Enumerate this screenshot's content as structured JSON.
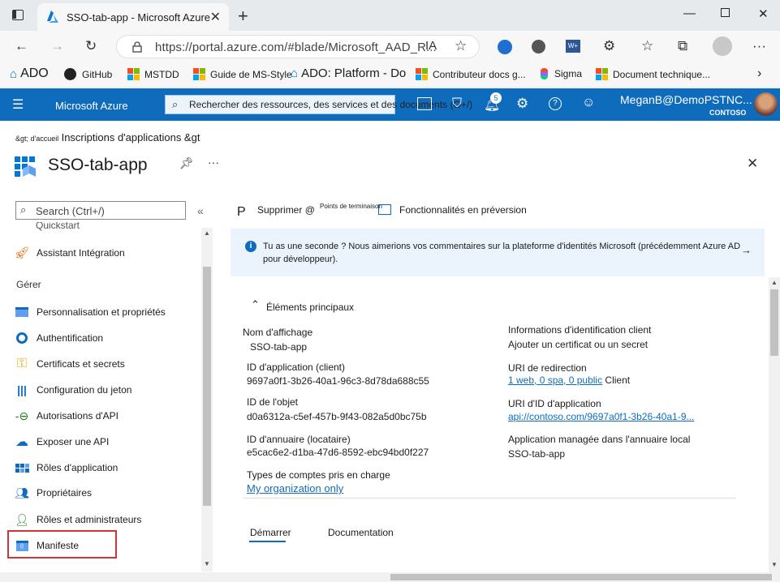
{
  "browser": {
    "tab_title": "SSO-tab-app - Microsoft Azure",
    "url": "https://portal.azure.com/#blade/Microsoft_AAD_R...",
    "address_suffix": "IA",
    "extension_badge": "W+",
    "bookmarks": [
      {
        "label": "ADO",
        "icon": "ado-icon"
      },
      {
        "label": "GitHub",
        "icon": "github-icon"
      },
      {
        "label": "MSTDD",
        "icon": "microsoft-icon"
      },
      {
        "label": "Guide de MS-Style",
        "icon": "microsoft-icon"
      },
      {
        "label": "ADO: Platform - Do",
        "icon": "ado-icon"
      },
      {
        "label": "Contributeur docs g...",
        "icon": "microsoft-icon"
      },
      {
        "label": "Sigma",
        "icon": "figma-icon"
      },
      {
        "label": "Document technique...",
        "icon": "microsoft-icon"
      }
    ]
  },
  "azure": {
    "brand": "Microsoft Azure",
    "search_placeholder": "Rechercher des ressources, des services et des documents (G+/)",
    "notification_count": "5",
    "user_name": "MeganB@DemoPSTNC...",
    "tenant": "CONTOSO"
  },
  "breadcrumb": {
    "part1": "&gt; d'accueil",
    "part2": "Inscriptions d'applications &gt"
  },
  "blade": {
    "title": "SSO-tab-app",
    "search_placeholder": "Search (Ctrl+/)",
    "collapse": "«",
    "cutoff_item": "Quickstart",
    "integration_item": "Assistant Intégration",
    "manage_header": "Gérer",
    "manage_items": [
      {
        "label": "Personnalisation et propriétés",
        "icon": "branding-icon"
      },
      {
        "label": "Authentification",
        "icon": "authentication-icon"
      },
      {
        "label": "Certificats et secrets",
        "icon": "key-icon"
      },
      {
        "label": "Configuration du jeton",
        "icon": "token-icon"
      },
      {
        "label": "Autorisations d'API",
        "icon": "api-permissions-icon"
      },
      {
        "label": "Exposer une API",
        "icon": "cloud-icon"
      },
      {
        "label": "Rôles d'application",
        "icon": "app-roles-icon"
      },
      {
        "label": "Propriétaires",
        "icon": "owners-icon"
      },
      {
        "label": "Rôles et administrateurs",
        "icon": "admin-roles-icon"
      },
      {
        "label": "Manifeste",
        "icon": "manifest-icon"
      }
    ]
  },
  "commandbar": {
    "p": "P",
    "delete": "Supprimer @",
    "endpoints": "Points de terminaison",
    "preview": "Fonctionnalités en préversion"
  },
  "banner": {
    "text": "Tu as une seconde ? Nous aimerions vos commentaires sur la plateforme d'identités Microsoft (précédemment Azure AD pour développeur)."
  },
  "essentials": {
    "header": "Éléments principaux",
    "display_name_label": "Nom d'affichage",
    "display_name_value": "SSO-tab-app",
    "app_id_label": "ID d'application (client)",
    "app_id_value": "9697a0f1-3b26-40a1-96c3-8d78da688c55",
    "object_id_label": "ID de l'objet",
    "object_id_value": "d0a6312a-c5ef-457b-9f43-082a5d0bc75b",
    "tenant_id_label": "ID d'annuaire (locataire)",
    "tenant_id_value": "e5cac6e2-d1ba-47d6-8592-ebc94bd0f227",
    "account_types_label": "Types de comptes pris en charge",
    "account_types_value": "My organization only",
    "client_creds_label": "Informations d'identification client",
    "client_creds_value": "Ajouter un certificat ou un secret",
    "redirect_label": "URI de redirection",
    "redirect_value": "1 web, 0 spa, 0 public",
    "redirect_suffix": "Client",
    "app_uri_label": "URI d'ID d'application",
    "app_uri_value": "api://contoso.com/9697a0f1-3b26-40a1-9...",
    "managed_app_label": "Application managée dans l'annuaire local",
    "managed_app_value": "SSO-tab-app"
  },
  "tabs": [
    {
      "label": "Démarrer"
    },
    {
      "label": "Documentation"
    }
  ]
}
